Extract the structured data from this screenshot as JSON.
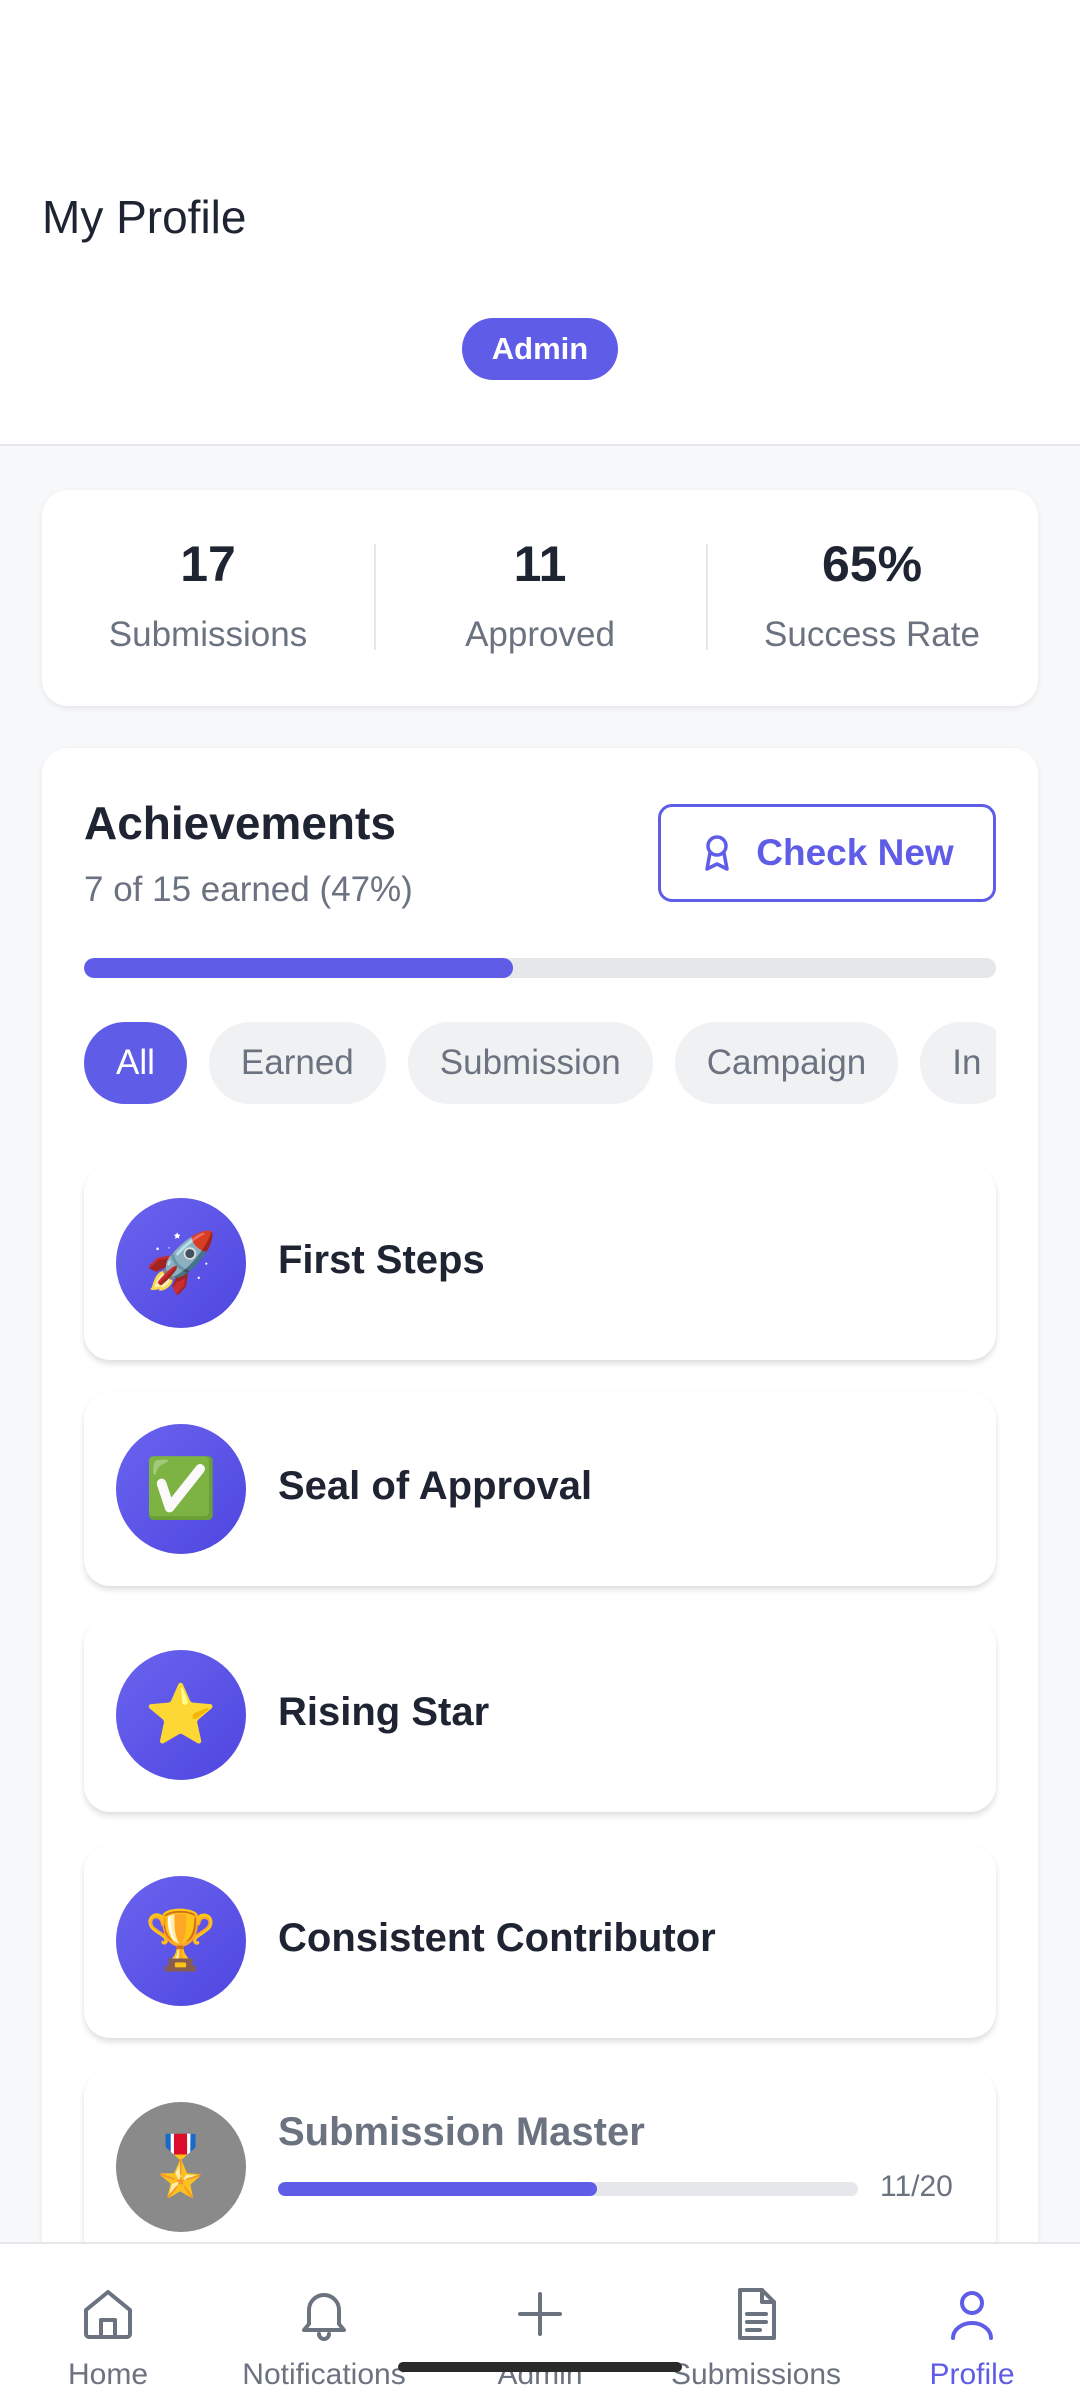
{
  "header": {
    "title": "My Profile",
    "role_badge": "Admin"
  },
  "stats": [
    {
      "value": "17",
      "label": "Submissions"
    },
    {
      "value": "11",
      "label": "Approved"
    },
    {
      "value": "65%",
      "label": "Success Rate"
    }
  ],
  "achievements": {
    "title": "Achievements",
    "subtitle": "7 of 15 earned (47%)",
    "progress_fraction": 0.47,
    "check_new_label": "Check New",
    "check_new_icon": "award-ribbon-icon",
    "filters": [
      {
        "label": "All",
        "active": true
      },
      {
        "label": "Earned",
        "active": false
      },
      {
        "label": "Submission",
        "active": false
      },
      {
        "label": "Campaign",
        "active": false
      },
      {
        "label": "In",
        "active": false
      }
    ],
    "items": [
      {
        "name": "First Steps",
        "emoji": "🚀",
        "icon": "rocket-icon",
        "earned": true
      },
      {
        "name": "Seal of Approval",
        "emoji": "✅",
        "icon": "check-mark-icon",
        "earned": true
      },
      {
        "name": "Rising Star",
        "emoji": "⭐",
        "icon": "star-icon",
        "earned": true
      },
      {
        "name": "Consistent Contributor",
        "emoji": "🏆",
        "icon": "trophy-icon",
        "earned": true
      },
      {
        "name": "Submission Master",
        "emoji": "🎖️",
        "icon": "medal-icon",
        "earned": false,
        "progress": "11/20",
        "progress_fraction": 0.55
      }
    ]
  },
  "nav": [
    {
      "label": "Home",
      "icon": "home-icon",
      "active": false
    },
    {
      "label": "Notifications",
      "icon": "bell-icon",
      "active": false
    },
    {
      "label": "Admin",
      "icon": "plus-icon",
      "active": false
    },
    {
      "label": "Submissions",
      "icon": "document-icon",
      "active": false
    },
    {
      "label": "Profile",
      "icon": "user-icon",
      "active": true
    }
  ],
  "colors": {
    "accent": "#5f5ce8",
    "muted_text": "#6b7280",
    "locked_icon": "#8a8a8a"
  }
}
